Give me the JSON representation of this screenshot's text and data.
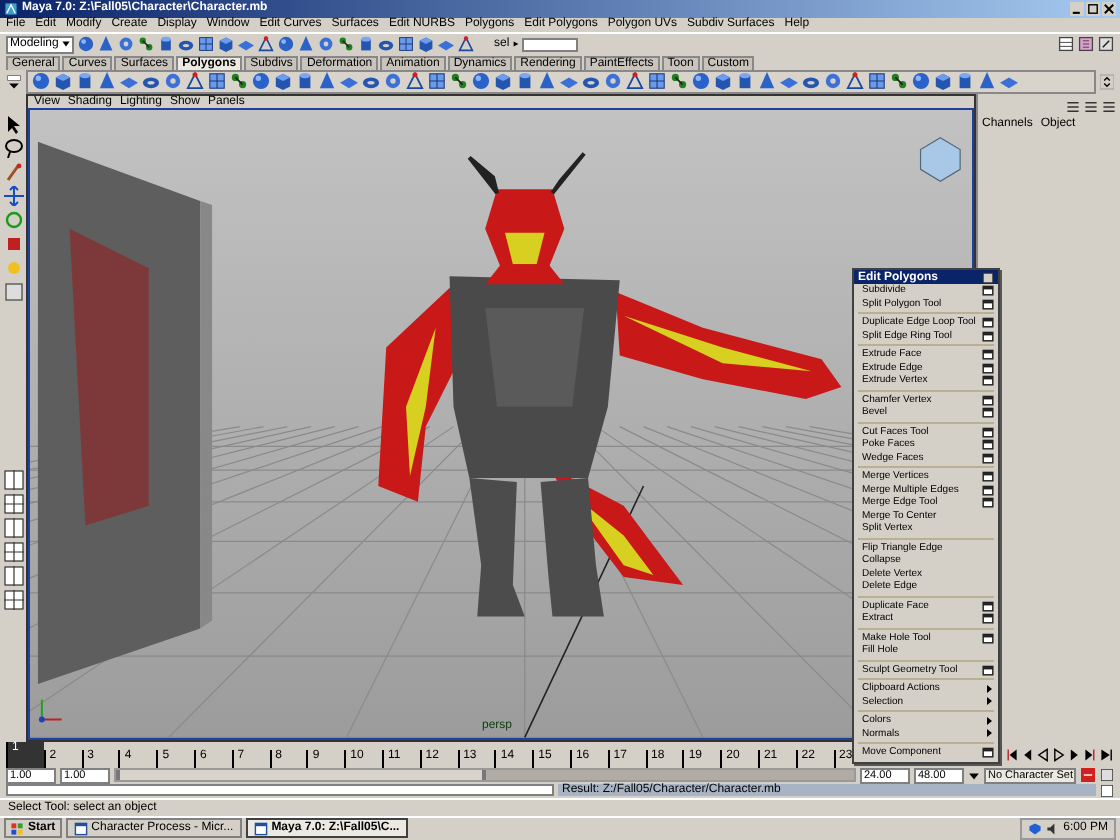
{
  "window": {
    "title": "Maya 7.0: Z:\\Fall05\\Character\\Character.mb"
  },
  "menu_bar": [
    "File",
    "Edit",
    "Modify",
    "Create",
    "Display",
    "Window",
    "Edit Curves",
    "Surfaces",
    "Edit NURBS",
    "Polygons",
    "Edit Polygons",
    "Polygon UVs",
    "Subdiv Surfaces",
    "Help"
  ],
  "status_line": {
    "mode": "Modeling",
    "selection_label": "sel"
  },
  "shelf_tabs": [
    {
      "label": "General",
      "selected": false
    },
    {
      "label": "Curves",
      "selected": false
    },
    {
      "label": "Surfaces",
      "selected": false
    },
    {
      "label": "Polygons",
      "selected": true
    },
    {
      "label": "Subdivs",
      "selected": false
    },
    {
      "label": "Deformation",
      "selected": false
    },
    {
      "label": "Animation",
      "selected": false
    },
    {
      "label": "Dynamics",
      "selected": false
    },
    {
      "label": "Rendering",
      "selected": false
    },
    {
      "label": "PaintEffects",
      "selected": false
    },
    {
      "label": "Toon",
      "selected": false
    },
    {
      "label": "Custom",
      "selected": false
    }
  ],
  "panel_menu": [
    "View",
    "Shading",
    "Lighting",
    "Show",
    "Panels"
  ],
  "viewport": {
    "camera": "persp"
  },
  "channel_box": {
    "tabs": [
      "Channels",
      "Object"
    ]
  },
  "time_slider": {
    "frames": [
      {
        "label": "1",
        "selected": true
      },
      {
        "label": "2",
        "selected": false
      },
      {
        "label": "3",
        "selected": false
      },
      {
        "label": "4",
        "selected": false
      },
      {
        "label": "5",
        "selected": false
      },
      {
        "label": "6",
        "selected": false
      },
      {
        "label": "7",
        "selected": false
      },
      {
        "label": "8",
        "selected": false
      },
      {
        "label": "9",
        "selected": false
      },
      {
        "label": "10",
        "selected": false
      },
      {
        "label": "11",
        "selected": false
      },
      {
        "label": "12",
        "selected": false
      },
      {
        "label": "13",
        "selected": false
      },
      {
        "label": "14",
        "selected": false
      },
      {
        "label": "15",
        "selected": false
      },
      {
        "label": "16",
        "selected": false
      },
      {
        "label": "17",
        "selected": false
      },
      {
        "label": "18",
        "selected": false
      },
      {
        "label": "19",
        "selected": false
      },
      {
        "label": "20",
        "selected": false
      },
      {
        "label": "21",
        "selected": false
      },
      {
        "label": "22",
        "selected": false
      },
      {
        "label": "23",
        "selected": false
      }
    ]
  },
  "range_slider": {
    "level": 0.5,
    "start": "1.00",
    "playback_start": "1.00",
    "playback_end": "24.00",
    "end": "48.00",
    "character_set": "No Character Set"
  },
  "command_line": {
    "result": "Result: Z:/Fall05/Character/Character.mb"
  },
  "help_line": "Select Tool: select an object",
  "context_menu": {
    "title": "Edit Polygons",
    "groups": [
      [
        {
          "label": "Subdivide",
          "kind": "option"
        },
        {
          "label": "Split Polygon Tool",
          "kind": "option"
        }
      ],
      [
        {
          "label": "Duplicate Edge Loop Tool",
          "kind": "option"
        },
        {
          "label": "Split Edge Ring Tool",
          "kind": "option"
        }
      ],
      [
        {
          "label": "Extrude Face",
          "kind": "option"
        },
        {
          "label": "Extrude Edge",
          "kind": "option"
        },
        {
          "label": "Extrude Vertex",
          "kind": "option"
        }
      ],
      [
        {
          "label": "Chamfer Vertex",
          "kind": "option"
        },
        {
          "label": "Bevel",
          "kind": "option"
        }
      ],
      [
        {
          "label": "Cut Faces Tool",
          "kind": "option"
        },
        {
          "label": "Poke Faces",
          "kind": "option"
        },
        {
          "label": "Wedge Faces",
          "kind": "option"
        }
      ],
      [
        {
          "label": "Merge Vertices",
          "kind": "option"
        },
        {
          "label": "Merge Multiple Edges",
          "kind": "option"
        },
        {
          "label": "Merge Edge Tool",
          "kind": "option"
        },
        {
          "label": "Merge To Center",
          "kind": "plain"
        },
        {
          "label": "Split Vertex",
          "kind": "plain"
        }
      ],
      [
        {
          "label": "Flip Triangle Edge",
          "kind": "plain"
        },
        {
          "label": "Collapse",
          "kind": "plain"
        },
        {
          "label": "Delete Vertex",
          "kind": "plain"
        },
        {
          "label": "Delete Edge",
          "kind": "plain"
        }
      ],
      [
        {
          "label": "Duplicate Face",
          "kind": "option"
        },
        {
          "label": "Extract",
          "kind": "option"
        }
      ],
      [
        {
          "label": "Make Hole Tool",
          "kind": "option"
        },
        {
          "label": "Fill Hole",
          "kind": "plain"
        }
      ],
      [
        {
          "label": "Sculpt Geometry Tool",
          "kind": "option"
        }
      ],
      [
        {
          "label": "Clipboard Actions",
          "kind": "submenu"
        },
        {
          "label": "Selection",
          "kind": "submenu"
        }
      ],
      [
        {
          "label": "Colors",
          "kind": "submenu"
        },
        {
          "label": "Normals",
          "kind": "submenu"
        }
      ],
      [
        {
          "label": "Move Component",
          "kind": "option"
        }
      ]
    ]
  },
  "taskbar": {
    "start": "Start",
    "tasks": [
      {
        "label": "Character Process - Micr...",
        "selected": false
      },
      {
        "label": "Maya 7.0: Z:\\Fall05\\C...",
        "selected": true
      }
    ],
    "clock": "6:00 PM"
  }
}
